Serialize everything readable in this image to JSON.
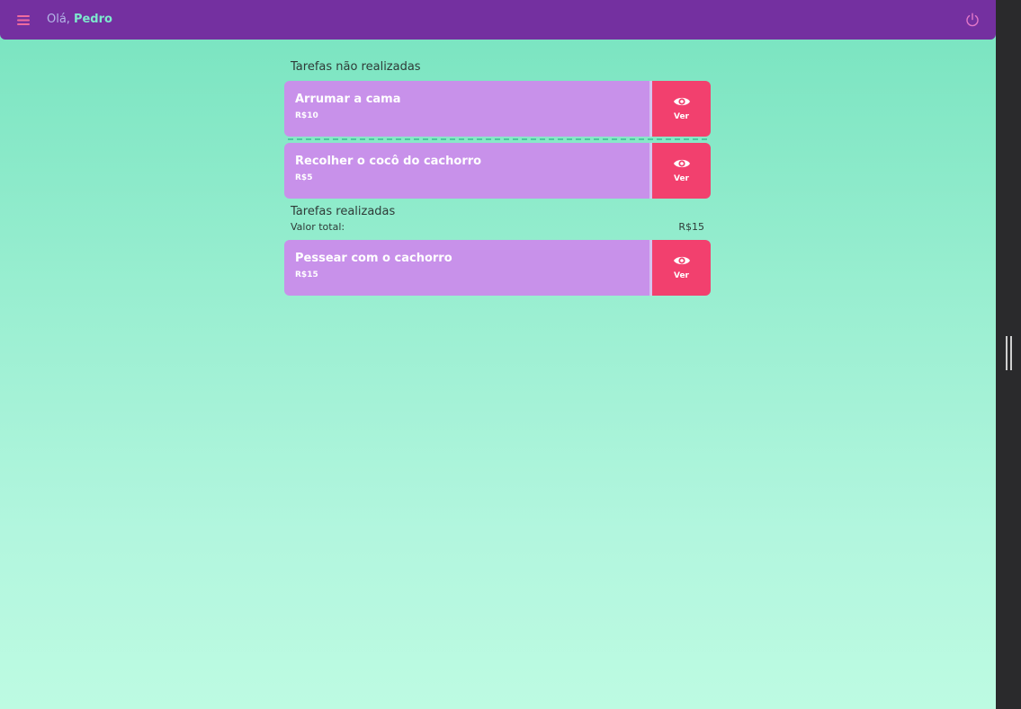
{
  "header": {
    "greeting": "Olá,",
    "user_name": "Pedro",
    "menu_icon": "hamburger-menu-icon",
    "logout_icon": "power-icon"
  },
  "pending": {
    "title": "Tarefas não realizadas",
    "tasks": [
      {
        "title": "Arrumar a cama",
        "value": "R$10",
        "view_label": "Ver"
      },
      {
        "title": "Recolher o cocô do cachorro",
        "value": "R$5",
        "view_label": "Ver"
      }
    ]
  },
  "completed": {
    "title": "Tarefas realizadas",
    "total_label": "Valor total:",
    "total_value": "R$15",
    "tasks": [
      {
        "title": "Pessear com o cachorro",
        "value": "R$15",
        "view_label": "Ver"
      }
    ]
  },
  "colors": {
    "header_bg": "#7430a0",
    "card_bg": "#c891ea",
    "view_button_bg": "#f2406e",
    "accent_name": "#7de8cd"
  }
}
